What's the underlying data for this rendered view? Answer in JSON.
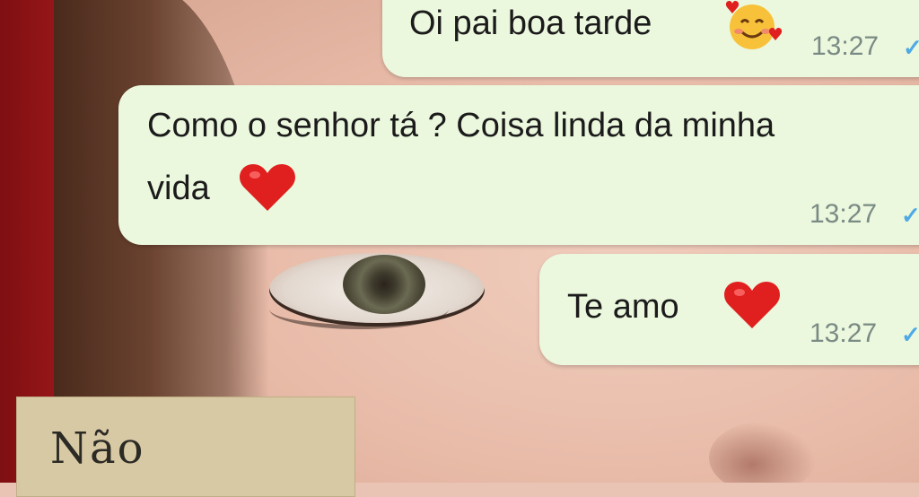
{
  "messages": [
    {
      "text": "Oi pai boa tarde",
      "emoji": "smiling-face-with-hearts",
      "time": "13:27"
    },
    {
      "line1": "Como o senhor tá ? Coisa linda da minha",
      "line2": "vida",
      "emoji": "red-heart",
      "time": "13:27"
    },
    {
      "text": "Te amo",
      "emoji": "red-heart",
      "time": "13:27"
    }
  ],
  "tick_symbol": "✓",
  "background_note": {
    "text": "Não"
  },
  "colors": {
    "bubble": "#ecf8dd",
    "tick": "#4ea9e4",
    "heart": "#e0201f"
  }
}
